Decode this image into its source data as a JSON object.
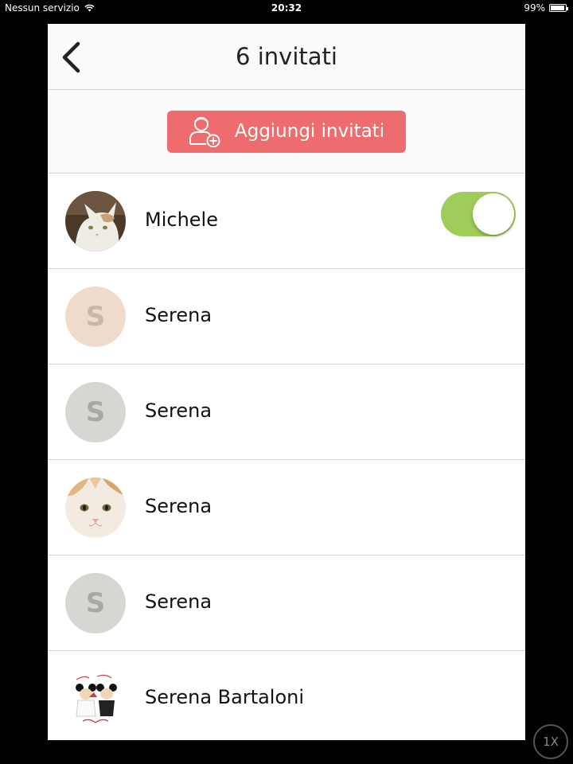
{
  "status_bar": {
    "carrier": "Nessun servizio",
    "time": "20:32",
    "battery": "99%"
  },
  "header": {
    "title": "6 invitati",
    "back_icon": "chevron-left-icon"
  },
  "add_button": {
    "label": "Aggiungi invitati",
    "icon": "add-person-icon",
    "color": "#ee6b6e"
  },
  "guests": [
    {
      "name": "Michele",
      "avatar": "cat-photo",
      "toggle": true
    },
    {
      "name": "Serena",
      "initial": "S",
      "avatar_bg": "#f0dacb",
      "avatar_fg": "#cbb6a8"
    },
    {
      "name": "Serena",
      "initial": "S",
      "avatar_bg": "#d6d6d2",
      "avatar_fg": "#a8a8a4"
    },
    {
      "name": "Serena",
      "avatar": "cat-face-photo"
    },
    {
      "name": "Serena",
      "initial": "S",
      "avatar_bg": "#d6d6d2",
      "avatar_fg": "#a8a8a4"
    },
    {
      "name": "Serena Bartaloni",
      "avatar": "wedding-cartoon-image"
    }
  ],
  "toggle_color": "#a0cc5a",
  "zoom_label": "1X"
}
